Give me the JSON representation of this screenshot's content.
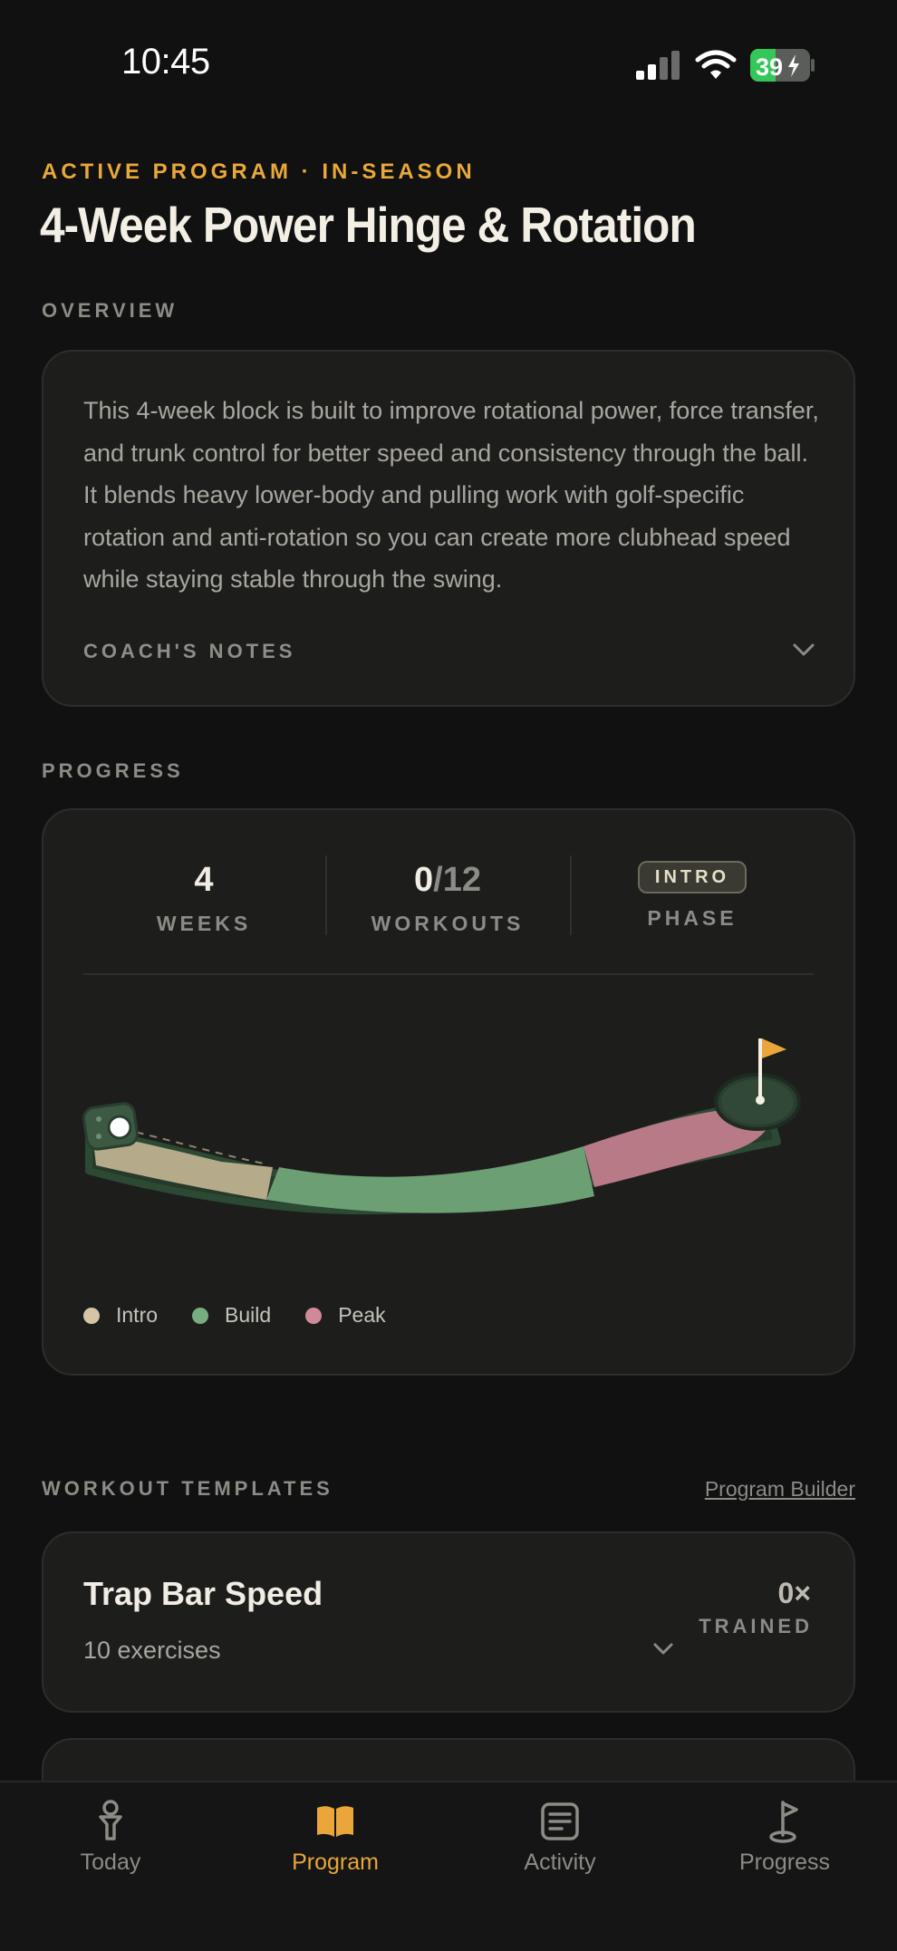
{
  "status_bar": {
    "time": "10:45",
    "battery": "39",
    "icons": [
      "signal-icon",
      "wifi-icon",
      "battery-icon"
    ]
  },
  "header": {
    "eyebrow": "ACTIVE PROGRAM · IN-SEASON",
    "title": "4-Week Power Hinge & Rotation"
  },
  "overview": {
    "section_label": "OVERVIEW",
    "text": "This 4-week block is built to improve rotational power, force transfer, and trunk control for better speed and consistency through the ball. It blends heavy lower-body and pulling work with golf-specific rotation and anti-rotation so you can create more clubhead speed while staying stable through the swing.",
    "coach_notes_label": "COACH'S NOTES"
  },
  "progress": {
    "section_label": "PROGRESS",
    "weeks_value": "4",
    "weeks_label": "WEEKS",
    "workouts_done": "0",
    "workouts_total": "/12",
    "workouts_label": "WORKOUTS",
    "phase_value": "INTRO",
    "phase_label": "PHASE",
    "legend": [
      {
        "label": "Intro",
        "color": "#d4c5a6"
      },
      {
        "label": "Build",
        "color": "#77ae7f"
      },
      {
        "label": "Peak",
        "color": "#cf8a98"
      }
    ]
  },
  "templates": {
    "section_label": "WORKOUT TEMPLATES",
    "builder_link": "Program Builder",
    "items": [
      {
        "name": "Trap Bar Speed",
        "count": "10 exercises",
        "trained_num": "0×",
        "trained_label": "TRAINED"
      }
    ]
  },
  "tabbar": {
    "tabs": [
      {
        "label": "Today",
        "icon": "golf-tee-icon",
        "active": false
      },
      {
        "label": "Program",
        "icon": "book-icon",
        "active": true
      },
      {
        "label": "Activity",
        "icon": "list-icon",
        "active": false
      },
      {
        "label": "Progress",
        "icon": "flag-icon",
        "active": false
      }
    ]
  },
  "colors": {
    "accent": "#e9a83a",
    "background": "#101110",
    "card": "#1d1e1c"
  }
}
